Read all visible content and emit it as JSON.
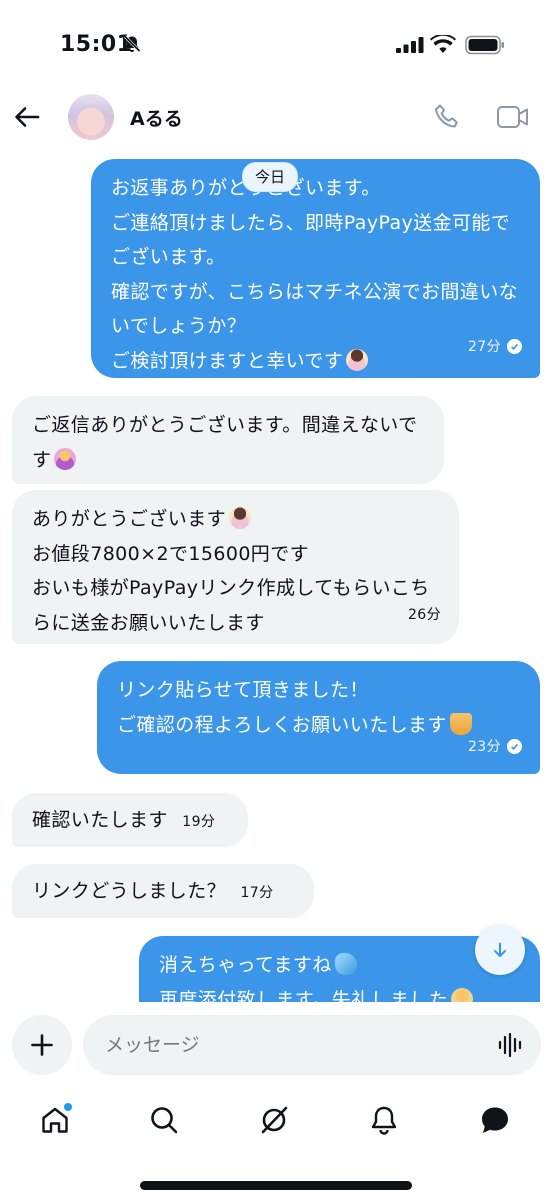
{
  "status_bar": {
    "time": "15:01"
  },
  "header": {
    "contact_name": "Aるる"
  },
  "date_divider": "今日",
  "messages": [
    {
      "direction": "out",
      "text": "お返事ありがとうございます。\nご連絡頂けましたら、即時PayPay送金可能でございます。\n確認ですが、こちらはマチネ公演でお間違いないでしょうか？\nご検討頂けますと幸いです",
      "emoji": "bowing-person-emoji",
      "time": "27分",
      "read": true
    },
    {
      "direction": "in",
      "text": "ご返信ありがとうございます。間違えないです",
      "emoji": "ok-gesture-person-emoji",
      "time": ""
    },
    {
      "direction": "in",
      "text": "ありがとうございます",
      "text2": "お値段7800×2で15600円です\nおいも様がPayPayリンク作成してもらいこちらに送金お願いいたします",
      "emoji": "bowing-person-emoji",
      "time": "26分"
    },
    {
      "direction": "out",
      "text": "リンク貼らせて頂きました！\nご確認の程よろしくお願いいたします",
      "emoji": "folded-hands-emoji",
      "time": "23分",
      "read": true
    },
    {
      "direction": "in",
      "text": "確認いたします",
      "time": "19分"
    },
    {
      "direction": "in",
      "text": "リンクどうしました？",
      "time": "17分"
    },
    {
      "direction": "out",
      "text": "消えちゃってますね",
      "text2": "再度添付致します。失礼しました",
      "emoji": "sweat-droplets-emoji",
      "emoji2": "bowing-person-emoji",
      "time": "",
      "read": false
    }
  ],
  "composer": {
    "placeholder": "メッセージ"
  },
  "bottom_nav": [
    "home",
    "search",
    "grok",
    "notifications",
    "messages"
  ],
  "colors": {
    "outgoing_bubble": "#3b96ea",
    "incoming_bubble": "#eff3f4",
    "accent": "#1d9bf0"
  }
}
